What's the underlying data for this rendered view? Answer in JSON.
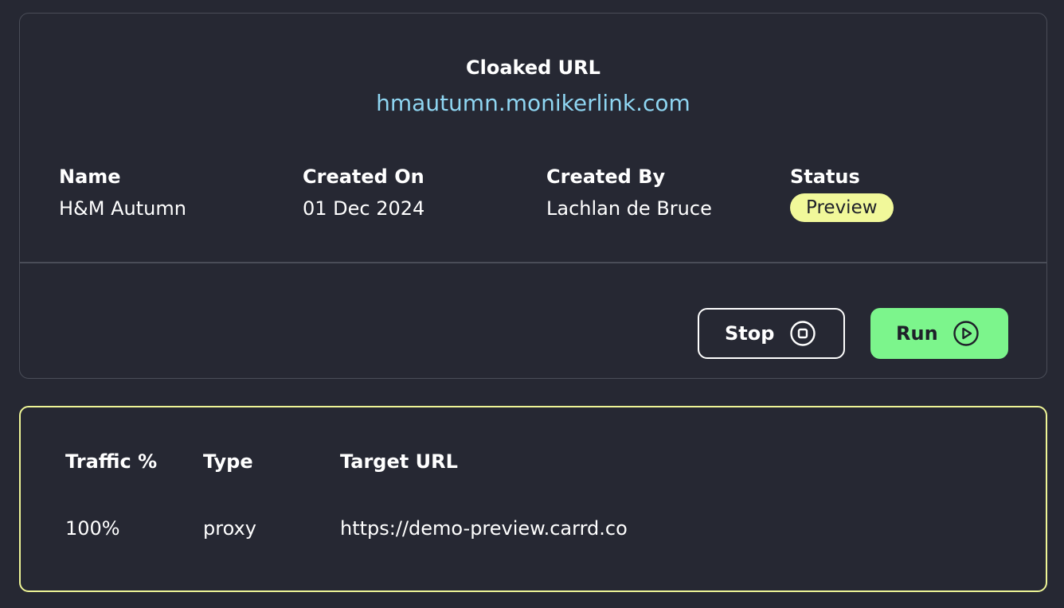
{
  "cloaked": {
    "label": "Cloaked URL",
    "url": "hmautumn.monikerlink.com"
  },
  "meta": {
    "name_label": "Name",
    "name_value": "H&M Autumn",
    "created_on_label": "Created On",
    "created_on_value": "01 Dec 2024",
    "created_by_label": "Created By",
    "created_by_value": "Lachlan de Bruce",
    "status_label": "Status",
    "status_value": "Preview"
  },
  "actions": {
    "stop_label": "Stop",
    "run_label": "Run",
    "stop_icon": "stop-circle-icon",
    "run_icon": "play-circle-icon"
  },
  "routes": {
    "headers": [
      "Traffic %",
      "Type",
      "Target URL"
    ],
    "rows": [
      [
        "100%",
        "proxy",
        "https://demo-preview.carrd.co"
      ]
    ]
  },
  "colors": {
    "background": "#262833",
    "link": "#8fd6f2",
    "status_badge": "#f1f89a",
    "run_button": "#7cf58c",
    "routes_border": "#eef596"
  }
}
